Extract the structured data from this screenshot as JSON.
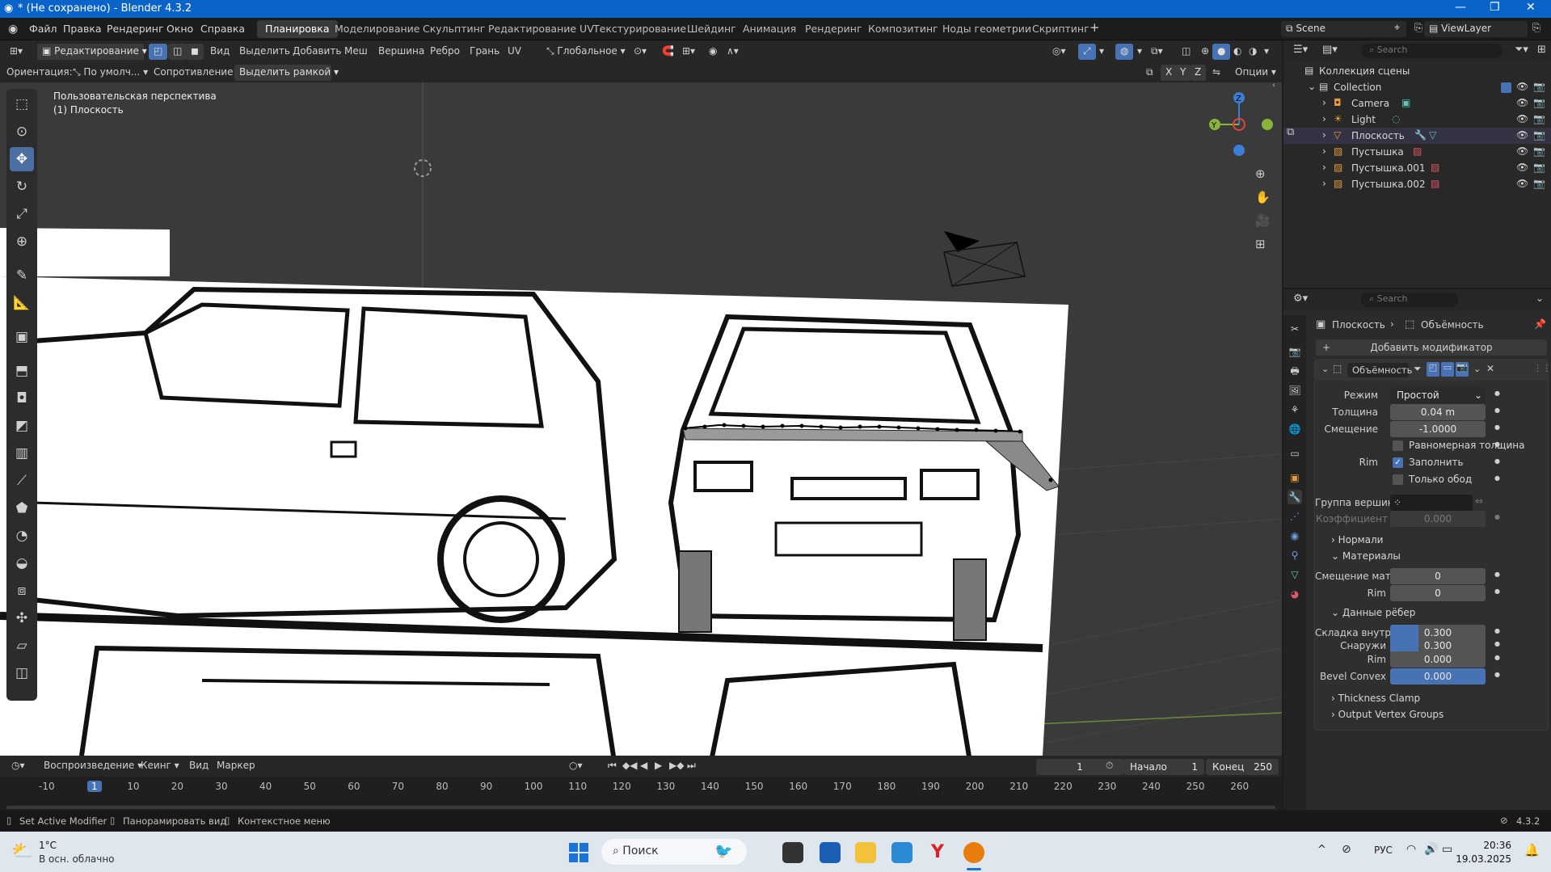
{
  "window": {
    "title": "* (Не сохранено) - Blender 4.3.2"
  },
  "menu": [
    "Файл",
    "Правка",
    "Рендеринг",
    "Окно",
    "Справка"
  ],
  "workspaces": [
    "Планировка",
    "Моделирование",
    "Скульптинг",
    "Редактирование UV",
    "Текстурирование",
    "Шейдинг",
    "Анимация",
    "Рендеринг",
    "Композитинг",
    "Ноды геометрии",
    "Скриптинг"
  ],
  "active_workspace": "Планировка",
  "scene": "Scene",
  "view_layer": "ViewLayer",
  "header": {
    "mode": "Редактирование",
    "menus": [
      "Вид",
      "Выделить",
      "Добавить",
      "Меш",
      "Вершина",
      "Ребро",
      "Грань",
      "UV"
    ],
    "transform": "Глобальное"
  },
  "tool_settings": {
    "orientation_label": "Ориентация:",
    "orientation_value": "По умолч...",
    "drag_label": "Сопротивление:",
    "drag_value": "Выделить рамкой",
    "axes": [
      "X",
      "Y",
      "Z"
    ],
    "options": "Опции"
  },
  "viewport": {
    "view_name": "Пользовательская перспектива",
    "object_name": "(1) Плоскость"
  },
  "outliner": {
    "search_placeholder": "Search",
    "root": "Коллекция сцены",
    "collection": "Collection",
    "items": [
      "Camera",
      "Light",
      "Плоскость",
      "Пустышка",
      "Пустышка.001",
      "Пустышка.002"
    ]
  },
  "properties": {
    "search_placeholder": "Search",
    "breadcrumb_object": "Плоскость",
    "breadcrumb_modifier": "Объёмность",
    "add_modifier": "Добавить модификатор",
    "modifier_name": "Объёмность",
    "mode_label": "Режим",
    "mode_value": "Простой",
    "thickness_label": "Толщина",
    "thickness_value": "0.04 m",
    "offset_label": "Смещение",
    "offset_value": "-1.0000",
    "even_thickness": "Равномерная толщина",
    "rim_label": "Rim",
    "fill_label": "Заполнить",
    "only_rim": "Только обод",
    "vgroup_label": "Группа вершин",
    "factor_label": "Коэффициент",
    "factor_value": "0.000",
    "normals": "Нормали",
    "materials": "Материалы",
    "mat_offset_label": "Смещение мате...",
    "mat_offset_value": "0",
    "mat_rim_label": "Rim",
    "mat_rim_value": "0",
    "edge_data": "Данные рёбер",
    "crease_inner_label": "Складка внутре...",
    "crease_inner_value": "0.300",
    "crease_outer_label": "Снаружи",
    "crease_outer_value": "0.300",
    "crease_rim_label": "Rim",
    "crease_rim_value": "0.000",
    "bevel_convex_label": "Bevel Convex",
    "bevel_convex_value": "0.000",
    "thickness_clamp": "Thickness Clamp",
    "output_vgroups": "Output Vertex Groups"
  },
  "timeline": {
    "playback": "Воспроизведение",
    "keying": "Кеинг",
    "view": "Вид",
    "marker": "Маркер",
    "current_frame": "1",
    "start_label": "Начало",
    "start_value": "1",
    "end_label": "Конец",
    "end_value": "250",
    "ticks": [
      "-10",
      "1",
      "10",
      "20",
      "30",
      "40",
      "50",
      "60",
      "70",
      "80",
      "90",
      "100",
      "110",
      "120",
      "130",
      "140",
      "150",
      "160",
      "170",
      "180",
      "190",
      "200",
      "210",
      "220",
      "230",
      "240",
      "250",
      "260"
    ]
  },
  "status": {
    "hint1": "Set Active Modifier",
    "hint2": "Панорамировать вид",
    "hint3": "Контекстное меню",
    "version": "4.3.2"
  },
  "taskbar": {
    "temp": "1°C",
    "weather": "В осн. облачно",
    "search": "Поиск",
    "lang": "РУС",
    "time": "20:36",
    "date": "19.03.2025"
  },
  "colors": {
    "accent": "#4772b3",
    "titlebar": "#0a63c8",
    "axis_x": "#e0443d",
    "axis_y": "#8bb33a",
    "axis_z": "#3a7fd5"
  }
}
